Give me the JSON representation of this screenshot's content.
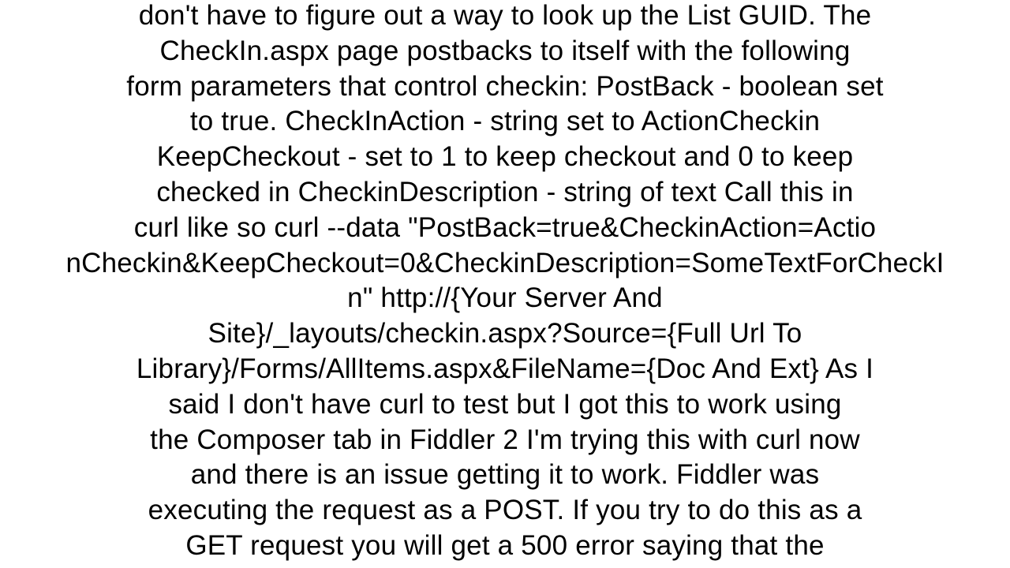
{
  "body": {
    "text": "don't have to figure out a way to look up the List GUID. The\nCheckIn.aspx page postbacks to itself with the following\nform parameters that control checkin: PostBack - boolean set\nto true. CheckInAction - string set to ActionCheckin\nKeepCheckout - set to 1 to keep checkout and 0 to keep\nchecked in CheckinDescription - string of text Call this in\ncurl like so  curl --data \"PostBack=true&CheckinAction=Actio\nnCheckin&KeepCheckout=0&CheckinDescription=SomeTextForCheckI\nn\" http://{Your Server And\nSite}/_layouts/checkin.aspx?Source={Full Url To\nLibrary}/Forms/AllItems.aspx&FileName={Doc And Ext} As I\nsaid I don't have curl to test but I got this to work using\nthe Composer tab in Fiddler 2 I'm trying this with curl now\nand there is an issue getting it to work. Fiddler was\nexecuting the request as a POST. If you try to do this as a\nGET request you will get a 500 error saying that the"
  }
}
